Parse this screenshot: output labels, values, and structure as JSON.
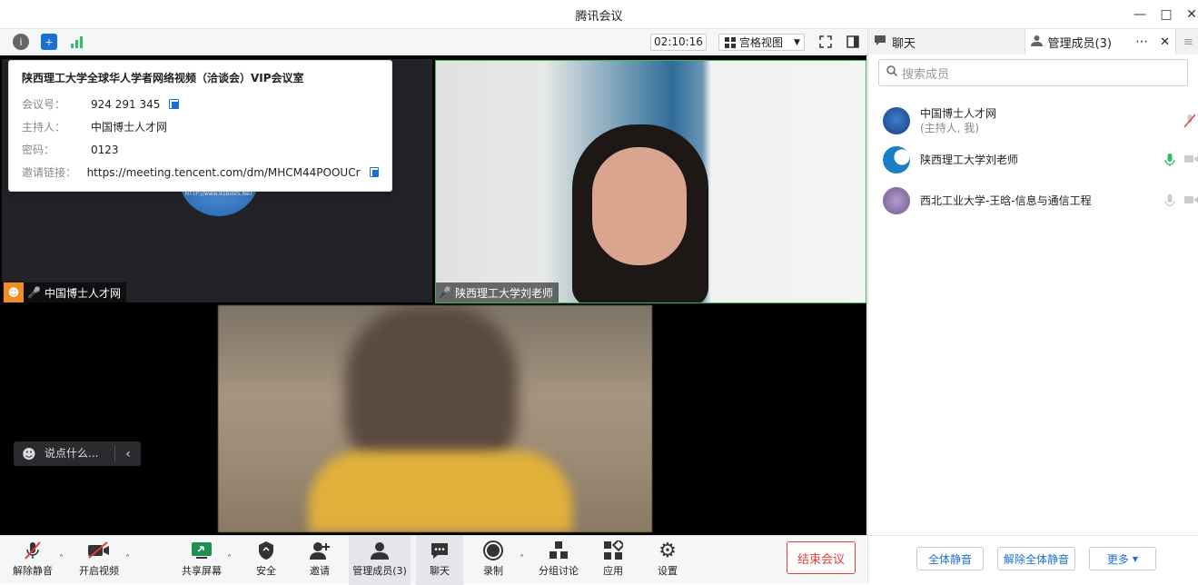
{
  "window": {
    "title": "腾讯会议"
  },
  "toolbar": {
    "timer": "02:10:16",
    "view_label": "宫格视图"
  },
  "meeting_info": {
    "title": "陕西理工大学全球华人学者网络视频（洽谈会）VIP会议室",
    "rows": [
      {
        "key": "会议号：",
        "value": "924 291 345",
        "copy": true
      },
      {
        "key": "主持人：",
        "value": "中国博士人才网",
        "copy": false
      },
      {
        "key": "密码：",
        "value": "0123",
        "copy": false
      },
      {
        "key": "邀请链接：",
        "value": "https://meeting.tencent.com/dm/MHCM44POOUCr",
        "copy": true
      }
    ],
    "logo_text": "HTTP://www.91boshi.NeT"
  },
  "tiles": {
    "tile1_name": "中国博士人才网",
    "tile2_name": "陕西理工大学刘老师"
  },
  "chat_input": {
    "placeholder": "说点什么..."
  },
  "bottom_bar": {
    "unmute": "解除静音",
    "start_video": "开启视频",
    "share_screen": "共享屏幕",
    "security": "安全",
    "invite": "邀请",
    "manage_members": "管理成员(3)",
    "chat": "聊天",
    "record": "录制",
    "breakout": "分组讨论",
    "apps": "应用",
    "settings": "设置",
    "end_meeting": "结束会议"
  },
  "side_panel": {
    "tab_chat": "聊天",
    "tab_members": "管理成员(3)",
    "search_placeholder": "搜索成员",
    "members": [
      {
        "name": "中国博士人才网",
        "sub": "(主持人, 我)"
      },
      {
        "name": "陕西理工大学刘老师",
        "sub": ""
      },
      {
        "name": "西北工业大学-王晗-信息与通信工程",
        "sub": ""
      }
    ],
    "mute_all": "全体静音",
    "unmute_all": "解除全体静音",
    "more": "更多"
  },
  "colors": {
    "accent": "#1a6fd6",
    "end_red": "#e23c39",
    "active_green": "#2fbf62",
    "host_orange": "#f08c2a"
  }
}
